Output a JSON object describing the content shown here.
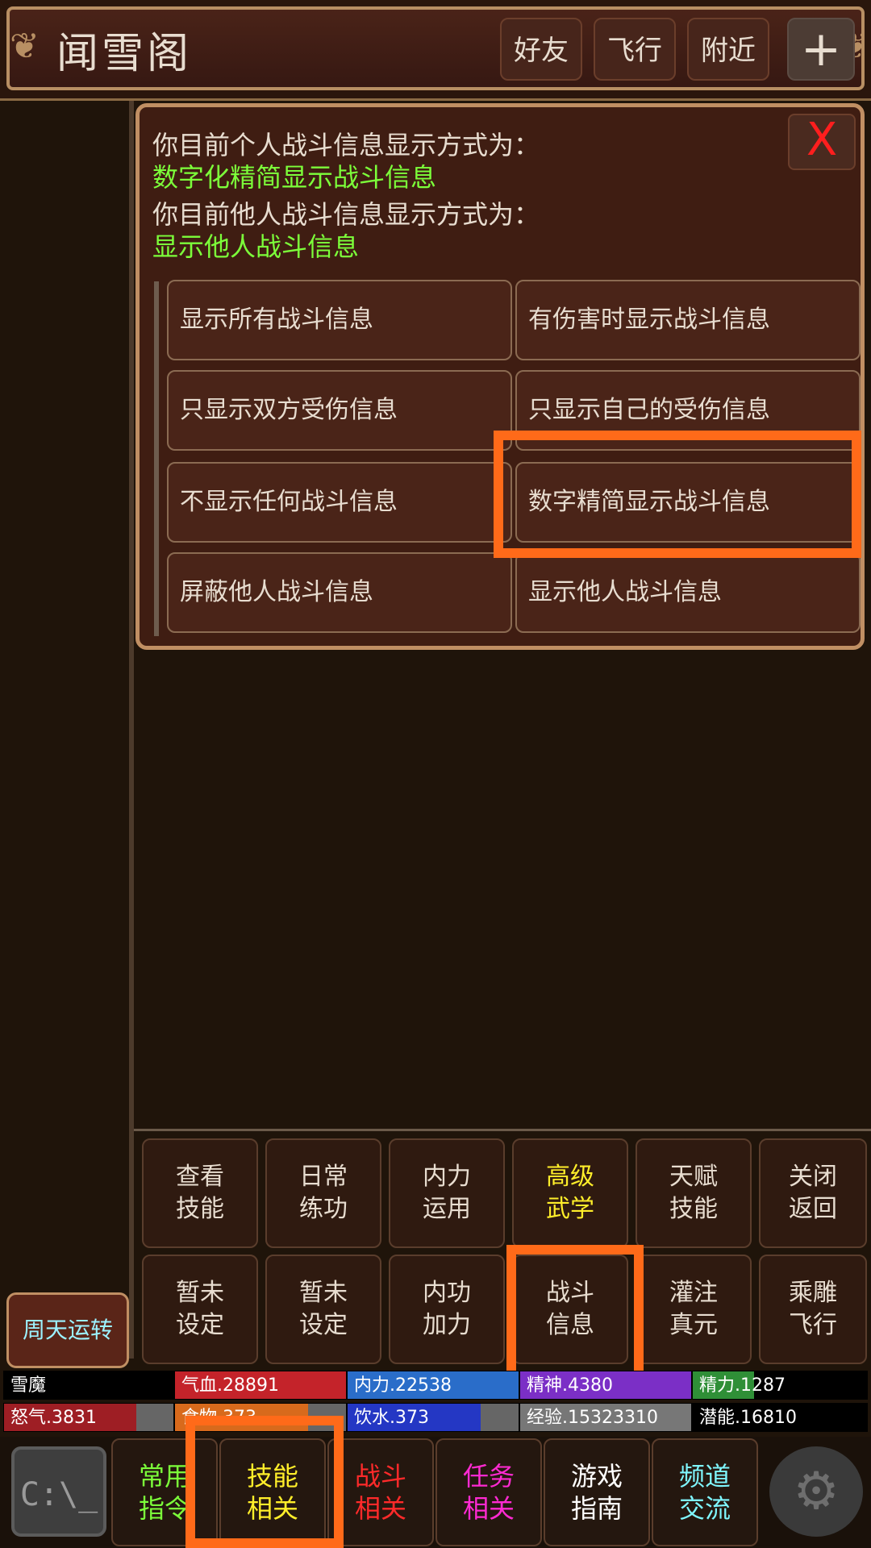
{
  "header": {
    "title": "闻雪阁",
    "buttons": {
      "friends": "好友",
      "fly": "飞行",
      "nearby": "附近",
      "plus": "+"
    }
  },
  "popup": {
    "line1": "你目前个人战斗信息显示方式为：",
    "line2": "数字化精简显示战斗信息",
    "line3": "你目前他人战斗信息显示方式为：",
    "line4": "显示他人战斗信息",
    "close": "X",
    "options": [
      "显示所有战斗信息",
      "有伤害时显示战斗信息",
      "只显示双方受伤信息",
      "只显示自己的受伤信息",
      "不显示任何战斗信息",
      "数字精简显示战斗信息",
      "屏蔽他人战斗信息",
      "显示他人战斗信息"
    ]
  },
  "grid": {
    "row1": [
      [
        "查看",
        "技能"
      ],
      [
        "日常",
        "练功"
      ],
      [
        "内力",
        "运用"
      ],
      [
        "高级",
        "武学"
      ],
      [
        "天赋",
        "技能"
      ],
      [
        "关闭",
        "返回"
      ]
    ],
    "row2": [
      [
        "暂未",
        "设定"
      ],
      [
        "暂未",
        "设定"
      ],
      [
        "内功",
        "加力"
      ],
      [
        "战斗",
        "信息"
      ],
      [
        "灌注",
        "真元"
      ],
      [
        "乘雕",
        "飞行"
      ]
    ]
  },
  "left_button": "周天运转",
  "stats": {
    "row1": [
      {
        "label": "雪魔",
        "color": "#000000",
        "fill": 1.0
      },
      {
        "label": "气血.28891",
        "color": "#c4232a",
        "fill": 1.0
      },
      {
        "label": "内力.22538",
        "color": "#2a6dc9",
        "fill": 1.0
      },
      {
        "label": "精神.4380",
        "color": "#7b2fc6",
        "fill": 1.0
      },
      {
        "label": "精力.1287",
        "color": "#2f8f37",
        "fill": 0.35
      }
    ],
    "row2": [
      {
        "label": "怒气.3831",
        "color": "#9e1e24",
        "fill": 0.78
      },
      {
        "label": "食物.373",
        "color": "#d86a1c",
        "fill": 0.78
      },
      {
        "label": "饮水.373",
        "color": "#2437c4",
        "fill": 0.78
      },
      {
        "label": "经验.15323310",
        "color": "#777777",
        "fill": 1.0
      },
      {
        "label": "潜能.16810",
        "color": "#000000",
        "fill": 1.0
      }
    ]
  },
  "bottom": [
    {
      "l1": "常用",
      "l2": "指令",
      "color": "#7cff3a"
    },
    {
      "l1": "技能",
      "l2": "相关",
      "color": "#ffee2a"
    },
    {
      "l1": "战斗",
      "l2": "相关",
      "color": "#ff2a2a"
    },
    {
      "l1": "任务",
      "l2": "相关",
      "color": "#ff2ad2"
    },
    {
      "l1": "游戏",
      "l2": "指南",
      "color": "#ffffff"
    },
    {
      "l1": "频道",
      "l2": "交流",
      "color": "#7ff7ff"
    }
  ],
  "icons": {
    "console": "C:\\_",
    "settings": "gear"
  }
}
